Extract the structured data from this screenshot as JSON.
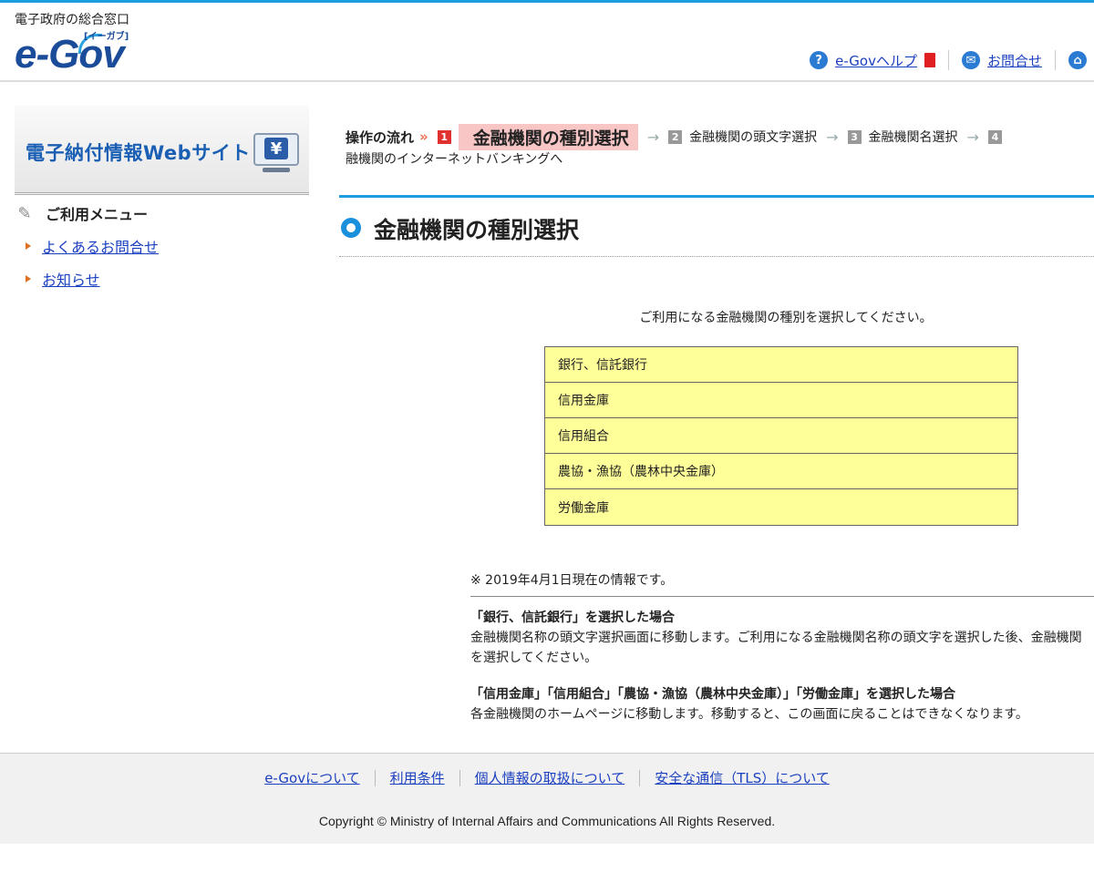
{
  "header": {
    "subtitle": "電子政府の総合窓口",
    "logo_text": "e-Gov",
    "logo_kana": "[イーガブ]",
    "nav": [
      {
        "label": "e-Govヘルプ"
      },
      {
        "label": "お問合せ"
      }
    ]
  },
  "sidebar": {
    "banner_title": "電子納付情報Webサイト",
    "banner_symbol": "¥",
    "menu_title": "ご利用メニュー",
    "items": [
      {
        "label": "よくあるお問合せ"
      },
      {
        "label": "お知らせ"
      }
    ]
  },
  "flow": {
    "label": "操作の流れ",
    "steps": [
      {
        "num": "1",
        "label": "金融機関の種別選択"
      },
      {
        "num": "2",
        "label": "金融機関の頭文字選択"
      },
      {
        "num": "3",
        "label": "金融機関名選択"
      },
      {
        "num": "4",
        "label": ""
      }
    ],
    "continuation": "融機関のインターネットバンキングへ"
  },
  "main": {
    "title": "金融機関の種別選択",
    "instruction": "ご利用になる金融機関の種別を選択してください。",
    "choices": [
      "銀行、信託銀行",
      "信用金庫",
      "信用組合",
      "農協・漁協（農林中央金庫）",
      "労働金庫"
    ],
    "note_date": "※ 2019年4月1日現在の情報です。",
    "note1_heading": "「銀行、信託銀行」を選択した場合",
    "note1_body": "金融機関名称の頭文字選択画面に移動します。ご利用になる金融機関名称の頭文字を選択した後、金融機関を選択してください。",
    "note2_heading": "「信用金庫」「信用組合」「農協・漁協（農林中央金庫）」「労働金庫」を選択した場合",
    "note2_body": "各金融機関のホームページに移動します。移動すると、この画面に戻ることはできなくなります。"
  },
  "footer": {
    "links": [
      "e-Govについて",
      "利用条件",
      "個人情報の取扱について",
      "安全な通信（TLS）について"
    ],
    "copyright": "Copyright © Ministry of Internal Affairs and Communications All Rights Reserved."
  },
  "colors": {
    "accent_blue": "#1a9ee0",
    "link": "#1a3fbf",
    "choice_bg": "#ffff99",
    "current_step_bg": "#f9c6c6"
  }
}
